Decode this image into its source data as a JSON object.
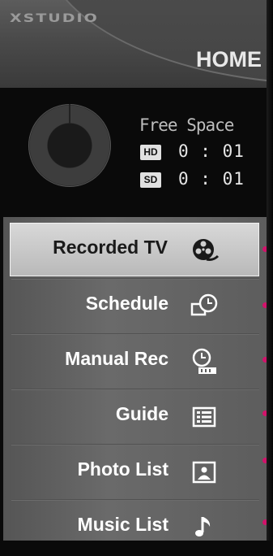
{
  "brand": {
    "logo_text": "XSTUDIO"
  },
  "header": {
    "title": "HOME"
  },
  "space": {
    "label": "Free Space",
    "hd_badge": "HD",
    "hd_time": "0 : 01",
    "sd_badge": "SD",
    "sd_time": "0 : 01"
  },
  "menu": {
    "items": [
      {
        "label": "Recorded TV",
        "icon": "film-reel-icon",
        "selected": true
      },
      {
        "label": "Schedule",
        "icon": "schedule-clock-icon",
        "selected": false
      },
      {
        "label": "Manual Rec",
        "icon": "manual-record-clock-icon",
        "selected": false
      },
      {
        "label": "Guide",
        "icon": "guide-list-icon",
        "selected": false
      },
      {
        "label": "Photo List",
        "icon": "photo-icon",
        "selected": false
      },
      {
        "label": "Music List",
        "icon": "music-note-icon",
        "selected": false
      }
    ]
  },
  "colors": {
    "indicator": "#d2136b",
    "selected_bg": "#c8c8c8",
    "panel_bg": "#0a0a0a"
  }
}
